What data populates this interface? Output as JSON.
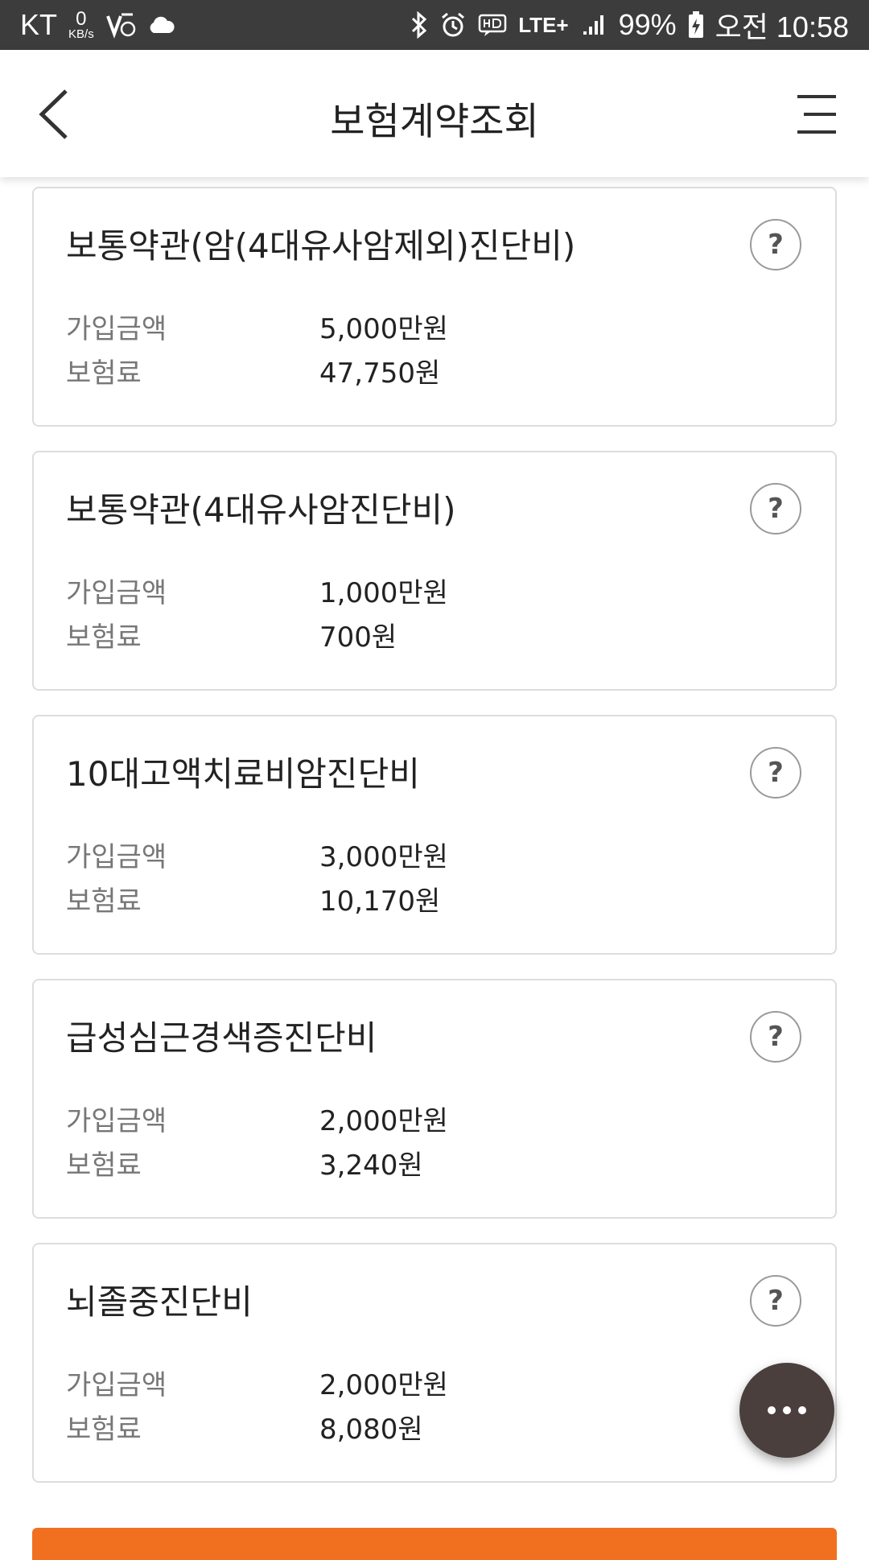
{
  "status_bar": {
    "carrier": "KT",
    "data_speed_value": "0",
    "data_speed_unit": "KB/s",
    "network": "LTE+",
    "battery": "99%",
    "time": "오전 10:58"
  },
  "header": {
    "title": "보험계약조회"
  },
  "labels": {
    "amount": "가입금액",
    "premium": "보험료"
  },
  "cards": [
    {
      "title": "보통약관(암(4대유사암제외)진단비)",
      "amount": "5,000만원",
      "premium": "47,750원",
      "help": "?"
    },
    {
      "title": "보통약관(4대유사암진단비)",
      "amount": "1,000만원",
      "premium": "700원",
      "help": "?"
    },
    {
      "title": "10대고액치료비암진단비",
      "amount": "3,000만원",
      "premium": "10,170원",
      "help": "?"
    },
    {
      "title": "급성심근경색증진단비",
      "amount": "2,000만원",
      "premium": "3,240원",
      "help": "?"
    },
    {
      "title": "뇌졸중진단비",
      "amount": "2,000만원",
      "premium": "8,080원",
      "help": "?"
    }
  ],
  "colors": {
    "accent": "#f07020",
    "fab": "#4a3f3c",
    "status_bar": "#3c3c3c"
  }
}
